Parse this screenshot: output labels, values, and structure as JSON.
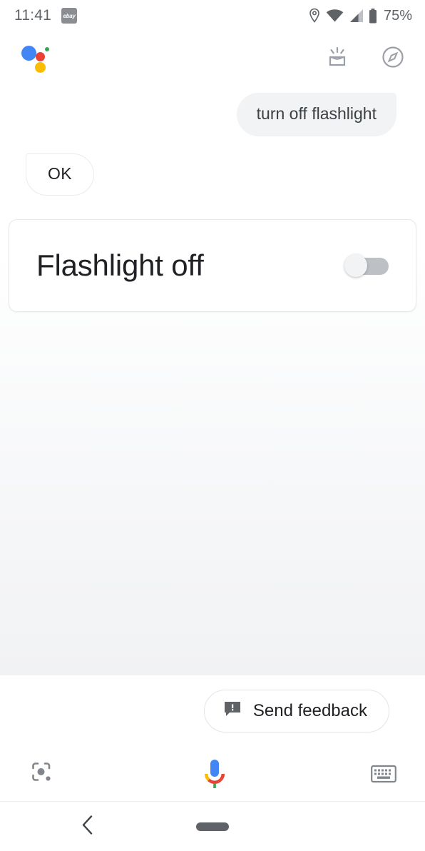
{
  "status_bar": {
    "time": "11:41",
    "notification_badge": "ebay",
    "battery_percent": "75%",
    "icons": [
      "location-pin-icon",
      "wifi-icon",
      "cellular-signal-icon",
      "battery-icon"
    ]
  },
  "header": {
    "logo": "google-assistant-logo",
    "icons": [
      {
        "name": "snapshot-icon",
        "label": "Snapshot"
      },
      {
        "name": "explore-icon",
        "label": "Explore"
      }
    ]
  },
  "conversation": {
    "user_message": "turn off flashlight",
    "assistant_reply": "OK"
  },
  "device_card": {
    "title": "Flashlight off",
    "toggle_name": "flashlight-toggle",
    "toggle_state": "off"
  },
  "footer": {
    "feedback_label": "Send feedback",
    "feedback_icon": "feedback-bubble-icon",
    "actions": [
      {
        "name": "lens-icon",
        "label": "Google Lens"
      },
      {
        "name": "microphone-icon",
        "label": "Voice input"
      },
      {
        "name": "keyboard-icon",
        "label": "Keyboard input"
      }
    ]
  },
  "navigation_bar": {
    "back": "back-icon",
    "home": "home-pill"
  },
  "colors": {
    "google_blue": "#4285f4",
    "google_red": "#ea4335",
    "google_yellow": "#fbbc04",
    "google_green": "#34a853",
    "icon_gray": "#9aa0a6",
    "text_primary": "#202124",
    "text_secondary": "#5f6368",
    "bubble_bg": "#f1f3f4"
  }
}
